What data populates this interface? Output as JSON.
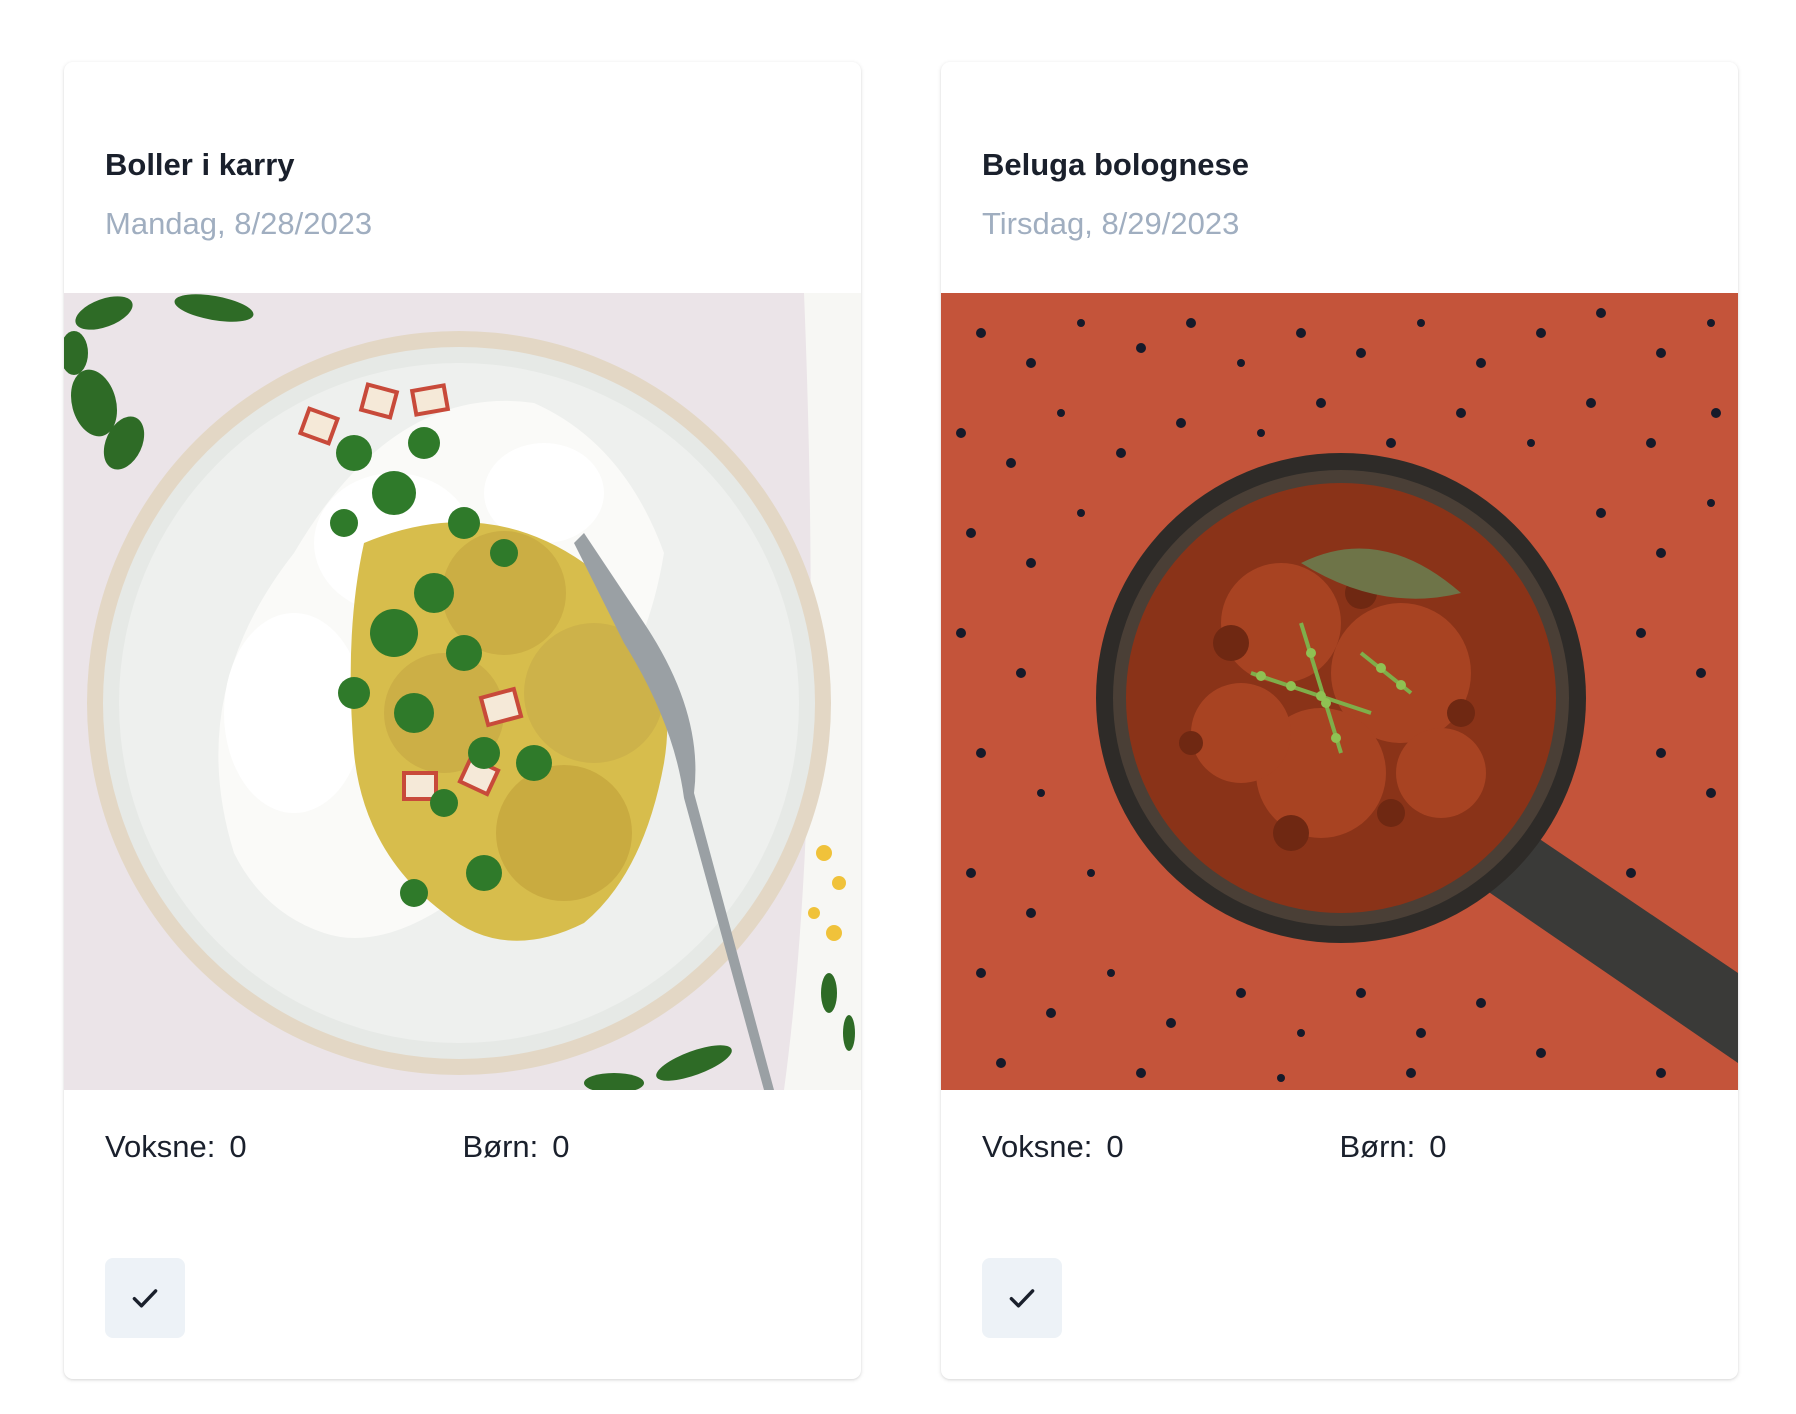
{
  "meals": [
    {
      "title": "Boller i karry",
      "date": "Mandag, 8/28/2023",
      "image": "curry-meatballs-with-rice-photo",
      "adults_label": "Voksne:",
      "adults_count": "0",
      "children_label": "Børn:",
      "children_count": "0",
      "confirm_icon": "check-icon"
    },
    {
      "title": "Beluga bolognese",
      "date": "Tirsdag, 8/29/2023",
      "image": "beluga-lentil-bolognese-pan-photo",
      "adults_label": "Voksne:",
      "adults_count": "0",
      "children_label": "Børn:",
      "children_count": "0",
      "confirm_icon": "check-icon"
    }
  ],
  "colors": {
    "title": "#1a202c",
    "date": "#a0aec0",
    "button_bg": "#edf2f7",
    "photo1_bg": "#ece6ea",
    "photo2_bg": "#c4543a"
  }
}
